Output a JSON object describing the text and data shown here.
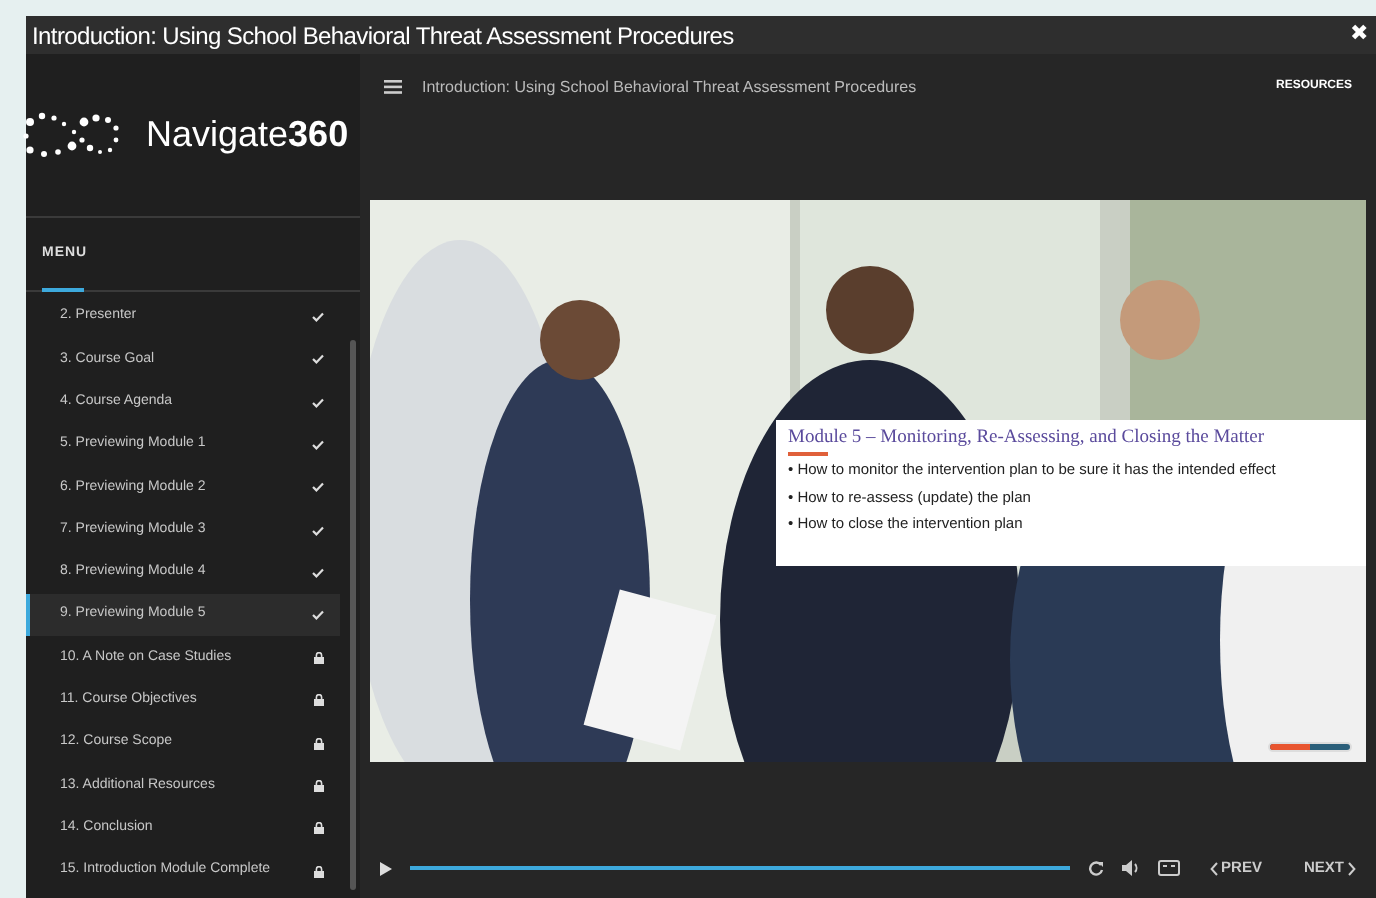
{
  "window": {
    "title": "Introduction: Using School Behavioral Threat Assessment Procedures",
    "close": "✖"
  },
  "logo": {
    "text": "Navigate**360**"
  },
  "header": {
    "title": "Introduction: Using School Behavioral Threat Assessment Procedures",
    "resources": "RESOURCES"
  },
  "menu": {
    "heading": "MENU",
    "items": [
      {
        "label": "2. Presenter",
        "completed": true,
        "selected": false
      },
      {
        "label": "3. Course Goal",
        "completed": true,
        "selected": false
      },
      {
        "label": "4. Course Agenda",
        "completed": true,
        "selected": false
      },
      {
        "label": "5. Previewing Module 1",
        "completed": true,
        "selected": false
      },
      {
        "label": "6. Previewing Module 2",
        "completed": true,
        "selected": false
      },
      {
        "label": "7. Previewing Module 3",
        "completed": true,
        "selected": false
      },
      {
        "label": "8. Previewing Module 4",
        "completed": true,
        "selected": false
      },
      {
        "label": "9. Previewing Module 5",
        "completed": true,
        "selected": true
      },
      {
        "label": "10. A Note on Case Studies",
        "completed": false,
        "selected": false
      },
      {
        "label": "11. Course Objectives",
        "completed": false,
        "selected": false
      },
      {
        "label": "12. Course Scope",
        "completed": false,
        "selected": false
      },
      {
        "label": "13. Additional Resources",
        "completed": false,
        "selected": false
      },
      {
        "label": "14. Conclusion",
        "completed": false,
        "selected": false
      },
      {
        "label": "15. Introduction Module Complete",
        "completed": false,
        "selected": false
      }
    ]
  },
  "slide": {
    "heading": "Module 5 – Monitoring, Re-Assessing, and Closing the Matter",
    "bullets": [
      "• How to monitor the intervention plan to be sure it has the intended effect",
      "• How to re-assess (update) the plan",
      "• How to close the intervention plan"
    ],
    "progress": {
      "level": 0.5
    }
  },
  "controls": {
    "prev": "PREV",
    "next": "NEXT"
  }
}
